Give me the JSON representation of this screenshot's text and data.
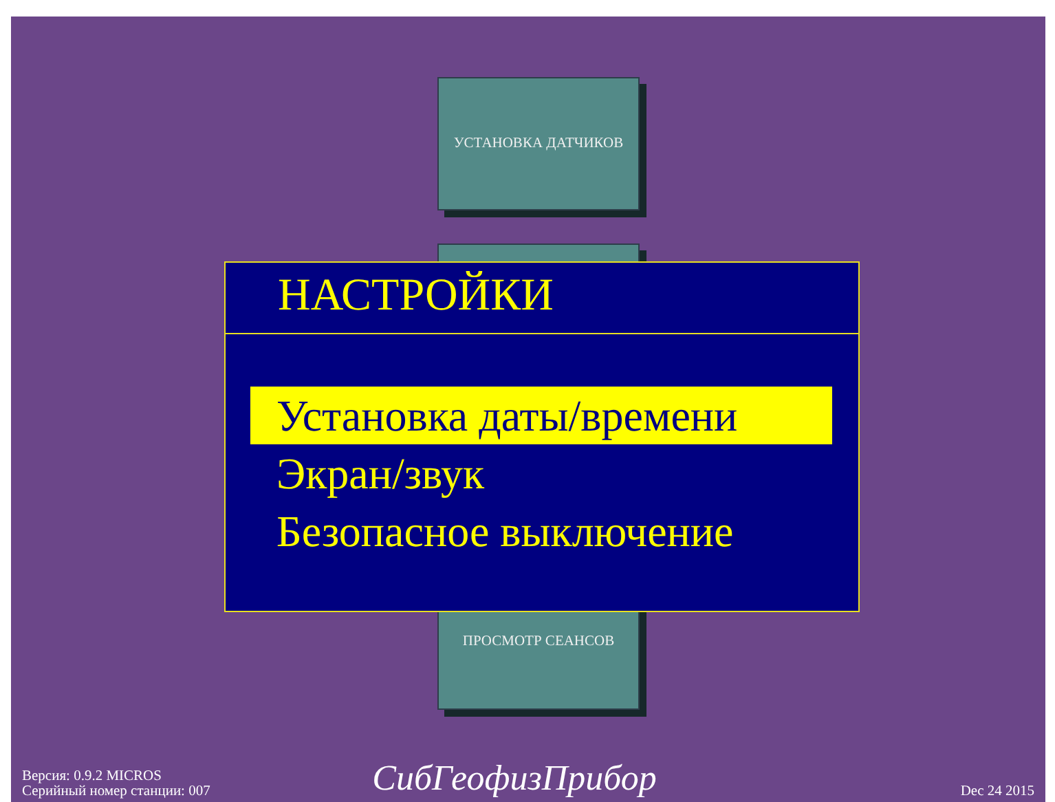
{
  "menu_buttons": [
    {
      "label": "УСТАНОВКА ДАТЧИКОВ",
      "kind": "labeled"
    },
    {
      "kind": "edge"
    },
    {
      "kind": "covered"
    },
    {
      "label": "ПРОСМОТР СЕАНСОВ",
      "kind": "labeled"
    }
  ],
  "dialog": {
    "title": "НАСТРОЙКИ",
    "items": [
      {
        "label": "Установка даты/времени",
        "selected": true
      },
      {
        "label": "Экран/звук",
        "selected": false
      },
      {
        "label": "Безопасное выключение",
        "selected": false
      }
    ]
  },
  "footer": {
    "version": "Версия: 0.9.2 MICROS",
    "serial": "Серийный номер станции: 007",
    "logo": "СибГеофизПрибор",
    "date": "Dec 24 2015"
  }
}
